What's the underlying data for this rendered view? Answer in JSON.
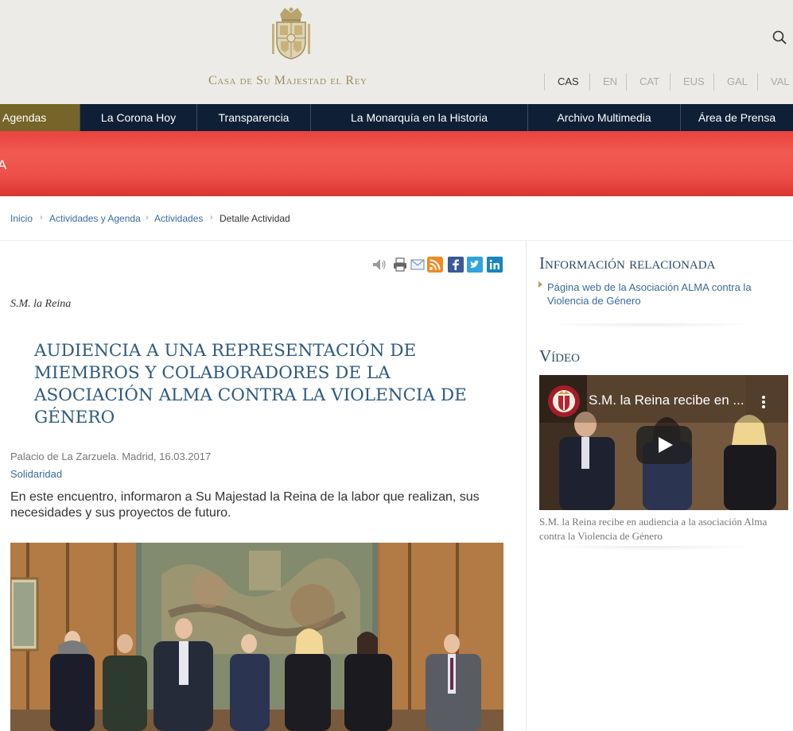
{
  "header": {
    "site_title": "Casa de Su Majestad el Rey",
    "search_icon": "search-icon",
    "crest_icon": "royal-crest-icon",
    "languages": [
      "CAS",
      "EN",
      "CAT",
      "EUS",
      "GAL",
      "VAL"
    ],
    "active_language": "CAS"
  },
  "nav": {
    "items": [
      "Agendas",
      "La Corona Hoy",
      "Transparencia",
      "La Monarquía en la Historia",
      "Archivo Multimedia",
      "Área de Prensa"
    ],
    "active": "Agendas"
  },
  "banner": {
    "partial_text": "A"
  },
  "breadcrumb": {
    "items": [
      "Inicio",
      "Actividades y Agenda",
      "Actividades",
      "Detalle Actividad"
    ]
  },
  "article": {
    "share_icons": [
      "audio-icon",
      "print-icon",
      "email-icon",
      "rss-icon",
      "facebook-icon",
      "twitter-icon",
      "linkedin-icon"
    ],
    "author": "S.M. la Reina",
    "title": "Audiencia a una representación de miembros y colaboradores de la Asociación ALMA contra la Violencia de Género",
    "meta": "Palacio de La Zarzuela. Madrid, 16.03.2017",
    "category": "Solidaridad",
    "lead": "En este encuentro, informaron a Su Majestad la Reina de la labor que realizan, sus necesidades y sus proyectos de futuro."
  },
  "sidebar": {
    "related_title": "Información relacionada",
    "related_link": "Página web de la Asociación ALMA contra la Violencia de Género",
    "video_title": "Vídeo",
    "video_overlay_title": "S.M. la Reina recibe en ...",
    "video_caption": "S.M. la Reina recibe en audiencia a la asociación Alma contra la Violencia de Género"
  },
  "colors": {
    "navy": "#0f2036",
    "gold": "#756528",
    "banner_red": "#ed4f48",
    "title_blue": "#2e5a7f",
    "link_blue": "#3a6aa0"
  }
}
